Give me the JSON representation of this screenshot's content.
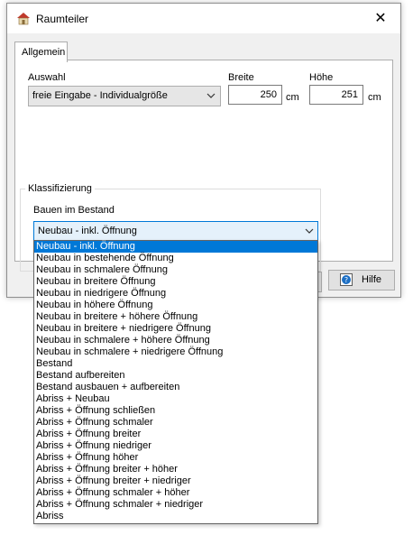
{
  "window": {
    "title": "Raumteiler",
    "close_symbol": "✕"
  },
  "tabs": [
    {
      "label": "Allgemein"
    }
  ],
  "auswahl": {
    "label": "Auswahl",
    "value": "freie Eingabe - Individualgröße"
  },
  "breite": {
    "label": "Breite",
    "value": "250",
    "unit": "cm"
  },
  "hoehe": {
    "label": "Höhe",
    "value": "251",
    "unit": "cm"
  },
  "klassifizierung": {
    "group_label": "Klassifizierung",
    "field_label": "Bauen im Bestand",
    "selected": "Neubau - inkl. Öffnung",
    "options": [
      "Neubau - inkl. Öffnung",
      "Neubau in bestehende Öffnung",
      "Neubau in schmalere Öffnung",
      "Neubau in breitere Öffnung",
      "Neubau in niedrigere Öffnung",
      "Neubau in höhere Öffnung",
      "Neubau in breitere + höhere Öffnung",
      "Neubau in breitere + niedrigere Öffnung",
      "Neubau in schmalere + höhere Öffnung",
      "Neubau in schmalere + niedrigere Öffnung",
      "Bestand",
      "Bestand aufbereiten",
      "Bestand ausbauen + aufbereiten",
      "Abriss + Neubau",
      "Abriss + Öffnung schließen",
      "Abriss + Öffnung schmaler",
      "Abriss + Öffnung breiter",
      "Abriss + Öffnung niedriger",
      "Abriss + Öffnung höher",
      "Abriss + Öffnung breiter + höher",
      "Abriss + Öffnung breiter + niedriger",
      "Abriss + Öffnung schmaler + höher",
      "Abriss + Öffnung schmaler + niedriger",
      "Abriss"
    ]
  },
  "buttons": {
    "help": "Hilfe"
  },
  "colors": {
    "accent": "#0078d7",
    "selected_bg": "#0078d7",
    "combo_focus_bg": "#e5f1fb"
  }
}
